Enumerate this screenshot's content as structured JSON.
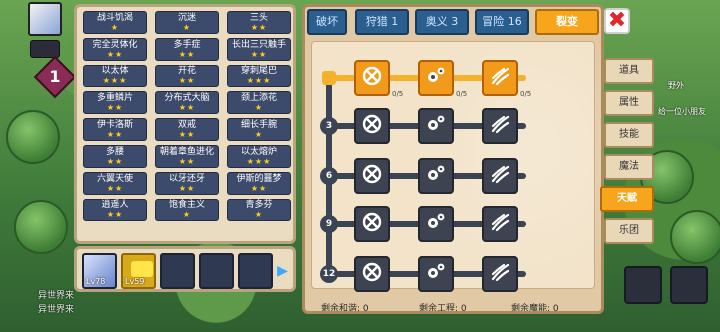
{
  "hud": {
    "level": "1"
  },
  "titles": [
    {
      "name": "战斗饥渴",
      "stars": "★"
    },
    {
      "name": "沉迷",
      "stars": "★"
    },
    {
      "name": "三头",
      "stars": "★★"
    },
    {
      "name": "完全灵体化",
      "stars": "★★"
    },
    {
      "name": "多手症",
      "stars": "★★"
    },
    {
      "name": "长出三只触手",
      "stars": "★★"
    },
    {
      "name": "以太体",
      "stars": "★★★"
    },
    {
      "name": "开花",
      "stars": "★★"
    },
    {
      "name": "穿刺尾巴",
      "stars": "★★★"
    },
    {
      "name": "多重鳞片",
      "stars": "★★"
    },
    {
      "name": "分布式大脑",
      "stars": "★★"
    },
    {
      "name": "颈上添花",
      "stars": "★"
    },
    {
      "name": "伊卡洛斯",
      "stars": "★★"
    },
    {
      "name": "双戒",
      "stars": "★★"
    },
    {
      "name": "细长手腕",
      "stars": "★"
    },
    {
      "name": "多腰",
      "stars": "★★"
    },
    {
      "name": "朝着章鱼进化",
      "stars": "★★"
    },
    {
      "name": "以太熔炉",
      "stars": "★★★"
    },
    {
      "name": "六翼天使",
      "stars": "★★"
    },
    {
      "name": "以牙还牙",
      "stars": "★★"
    },
    {
      "name": "伊斯的噩梦",
      "stars": "★★"
    },
    {
      "name": "逍遥人",
      "stars": "★★"
    },
    {
      "name": "饱食主义",
      "stars": "★"
    },
    {
      "name": "青多芬",
      "stars": "★"
    }
  ],
  "characters": [
    {
      "level": "Lv78"
    },
    {
      "level": "Lv59"
    }
  ],
  "chat": [
    "异世界来",
    "异世界来"
  ],
  "tabs": [
    "破坏",
    "狩猎 1",
    "奥义 3",
    "冒险 16",
    "裂变"
  ],
  "tree": {
    "rows": [
      "3",
      "6",
      "9",
      "12"
    ],
    "top_counts": [
      "0/5",
      "0/5",
      "0/5"
    ]
  },
  "footer": {
    "harmony": "剩余和谐: 0",
    "engineering": "剩余工程: 0",
    "magic": "剩余魔能: 0"
  },
  "side_menu": [
    "道具",
    "属性",
    "技能",
    "魔法",
    "天赋",
    "乐团"
  ],
  "right_labels": [
    "野外",
    "给一位小朋友"
  ],
  "colors": {
    "accent": "#f7a51c",
    "tab_blue": "#2a5e8f",
    "close_red": "#e3262a"
  }
}
